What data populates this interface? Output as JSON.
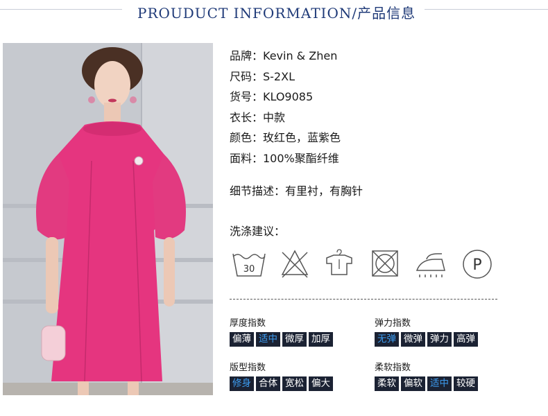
{
  "header": {
    "title": "PROUDUCT INFORMATION/产品信息"
  },
  "specs": [
    "品牌：Kevin & Zhen",
    "尺码：S-2XL",
    "货号：KLO9085",
    "衣长：中款",
    "颜色：玫红色，蓝紫色",
    "面料：100%聚酯纤维"
  ],
  "detail": "细节描述：有里衬，有胸针",
  "care": {
    "label": "洗涤建议：",
    "wash_temp": "30",
    "dryclean_letter": "P",
    "icons": [
      "wash-30-icon",
      "no-bleach-icon",
      "hang-dry-icon",
      "no-tumble-dry-icon",
      "iron-icon",
      "dry-clean-p-icon"
    ]
  },
  "indices": {
    "thickness": {
      "title": "厚度指数",
      "options": [
        "偏薄",
        "适中",
        "微厚",
        "加厚"
      ],
      "selected": "适中"
    },
    "elasticity": {
      "title": "弹力指数",
      "options": [
        "无弹",
        "微弹",
        "弹力",
        "高弹"
      ],
      "selected": "无弹"
    },
    "fit": {
      "title": "版型指数",
      "options": [
        "修身",
        "合体",
        "宽松",
        "偏大"
      ],
      "selected": "修身"
    },
    "softness": {
      "title": "柔软指数",
      "options": [
        "柔软",
        "偏软",
        "适中",
        "较硬"
      ],
      "selected": "适中"
    }
  },
  "colors": {
    "accent": "#1f3a78",
    "selected_option": "#3d9cf0",
    "option_bg": "#1b2233",
    "dress": "#e5357f"
  }
}
